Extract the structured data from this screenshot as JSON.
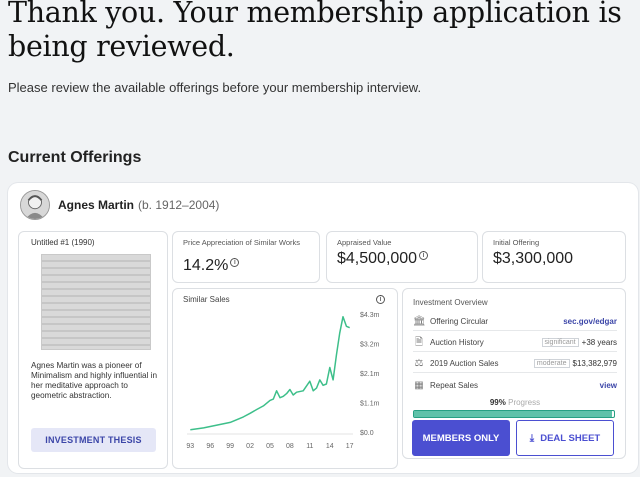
{
  "header": {
    "title": "Thank you. Your membership application is being reviewed.",
    "subtitle": "Please review the available offerings before your membership interview."
  },
  "section": {
    "title": "Current Offerings"
  },
  "offering": {
    "artist_name": "Agnes Martin",
    "artist_dates": "(b. 1912–2004)",
    "artwork_title": "Untitled #1 (1990)",
    "artwork_description": "Agnes Martin was a pioneer of Minimalism and highly influential in her meditative approach to geometric abstraction.",
    "thesis_button": "INVESTMENT THESIS",
    "metrics": [
      {
        "label": "Price Appreciation of Similar Works",
        "value": "14.2%"
      },
      {
        "label": "Appraised Value",
        "value": "$4,500,000"
      },
      {
        "label": "Initial Offering",
        "value": "$3,300,000"
      }
    ],
    "similar_sales_title": "Similar Sales",
    "overview": {
      "title": "Investment Overview",
      "rows": [
        {
          "label": "Offering Circular",
          "link": "sec.gov/edgar"
        },
        {
          "label": "Auction History",
          "tag": "significant",
          "value": "+38 years"
        },
        {
          "label": "2019 Auction Sales",
          "tag": "moderate",
          "value": "$13,382,979"
        },
        {
          "label": "Repeat Sales",
          "link": "view"
        }
      ],
      "progress_value": "99%",
      "progress_label": "Progress",
      "progress_fraction": 0.99
    },
    "members_button": "MEMBERS ONLY",
    "deal_button": "DEAL SHEET"
  },
  "chart_data": {
    "type": "line",
    "title": "Similar Sales",
    "x_ticks": [
      "93",
      "96",
      "99",
      "02",
      "05",
      "08",
      "11",
      "14",
      "17"
    ],
    "y_ticks": [
      "$0.0",
      "$1.1m",
      "$2.1m",
      "$3.2m",
      "$4.3m"
    ],
    "ylim": [
      0,
      4.3
    ],
    "x": [
      1993,
      1995,
      1997,
      1999,
      2000,
      2001,
      2002,
      2003,
      2004,
      2005,
      2005.5,
      2006,
      2006.5,
      2007,
      2007.5,
      2008,
      2008.5,
      2009,
      2010,
      2011,
      2011.5,
      2012,
      2012.5,
      2013,
      2013.5,
      2014,
      2014.5,
      2015,
      2015.5,
      2016,
      2016.5,
      2017
    ],
    "y": [
      0.08,
      0.15,
      0.25,
      0.35,
      0.45,
      0.55,
      0.68,
      0.82,
      0.95,
      1.15,
      1.2,
      1.5,
      1.25,
      1.3,
      1.4,
      1.55,
      1.35,
      1.45,
      1.5,
      1.85,
      1.5,
      1.6,
      1.9,
      1.7,
      1.75,
      2.35,
      1.9,
      2.8,
      3.6,
      4.2,
      3.85,
      3.8
    ],
    "grid": false,
    "legend": "none"
  }
}
